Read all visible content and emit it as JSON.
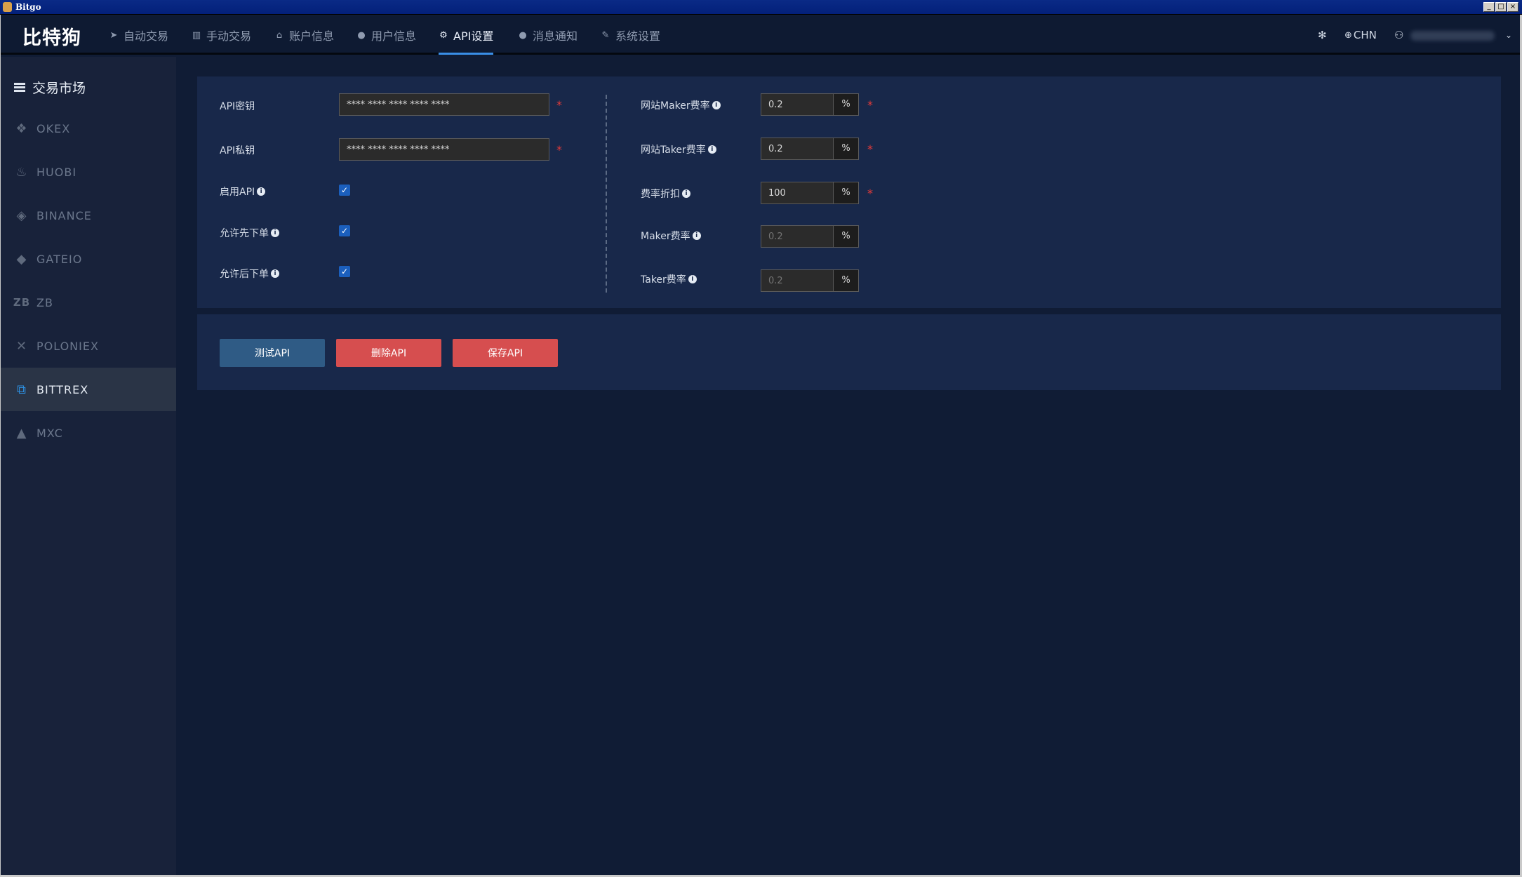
{
  "window": {
    "title": "Bitgo",
    "controls": {
      "minimize": "_",
      "maximize": "□",
      "close": "×"
    }
  },
  "topnav": {
    "brand": "比特狗",
    "items": [
      {
        "icon": "send-icon",
        "label": "自动交易"
      },
      {
        "icon": "chart-icon",
        "label": "手动交易"
      },
      {
        "icon": "bank-icon",
        "label": "账户信息"
      },
      {
        "icon": "user-icon",
        "label": "用户信息"
      },
      {
        "icon": "gears-icon",
        "label": "API设置",
        "active": true
      },
      {
        "icon": "chat-icon",
        "label": "消息通知"
      },
      {
        "icon": "wrench-icon",
        "label": "系统设置"
      }
    ],
    "right": {
      "settings_icon": "gear-icon",
      "language": "CHN",
      "account_icon": "user-icon"
    }
  },
  "sidebar": {
    "header": "交易市场",
    "items": [
      {
        "label": "OKEX",
        "icon": "okex-icon"
      },
      {
        "label": "HUOBI",
        "icon": "huobi-icon"
      },
      {
        "label": "BINANCE",
        "icon": "binance-icon"
      },
      {
        "label": "GATEIO",
        "icon": "gateio-icon"
      },
      {
        "label": "ZB",
        "icon": "zb-icon"
      },
      {
        "label": "POLONIEX",
        "icon": "poloniex-icon"
      },
      {
        "label": "BITTREX",
        "icon": "bittrex-icon",
        "active": true
      },
      {
        "label": "MXC",
        "icon": "mxc-icon"
      }
    ]
  },
  "form": {
    "left": {
      "api_key_label": "API密钥",
      "api_key_value": "**** **** **** **** ****",
      "api_secret_label": "API私钥",
      "api_secret_value": "**** **** **** **** ****",
      "enable_api_label": "启用API",
      "allow_first_label": "允许先下单",
      "allow_later_label": "允许后下单"
    },
    "right": {
      "site_maker_label": "网站Maker费率",
      "site_maker_value": "0.2",
      "site_taker_label": "网站Taker费率",
      "site_taker_value": "0.2",
      "discount_label": "费率折扣",
      "discount_value": "100",
      "maker_label": "Maker费率",
      "maker_placeholder": "0.2",
      "taker_label": "Taker费率",
      "taker_placeholder": "0.2",
      "percent": "%"
    },
    "required_mark": "*",
    "info_mark": "i",
    "check_mark": "✓"
  },
  "actions": {
    "test": "测试API",
    "delete": "删除API",
    "save": "保存API"
  },
  "colors": {
    "accent": "#3a8ee6",
    "danger": "#d64e4f",
    "primary_button": "#2f5b85",
    "panel": "#18284a",
    "background": "#101c35"
  }
}
